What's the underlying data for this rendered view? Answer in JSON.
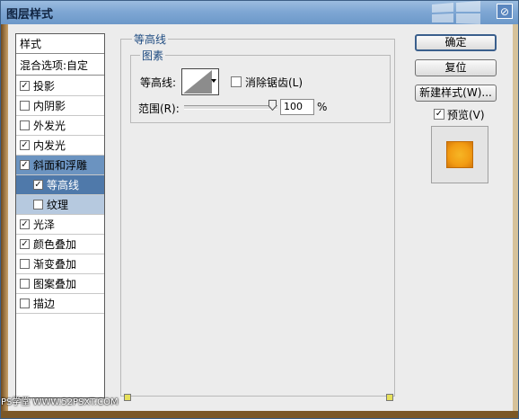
{
  "window": {
    "title": "图层样式",
    "close_icon": "close-icon"
  },
  "sidebar": {
    "header": "样式",
    "blend_options": "混合选项:自定",
    "items": [
      {
        "label": "投影",
        "checked": true
      },
      {
        "label": "内阴影",
        "checked": false
      },
      {
        "label": "外发光",
        "checked": false
      },
      {
        "label": "内发光",
        "checked": true
      },
      {
        "label": "斜面和浮雕",
        "checked": true
      },
      {
        "label": "等高线",
        "checked": true
      },
      {
        "label": "纹理",
        "checked": false
      },
      {
        "label": "光泽",
        "checked": true
      },
      {
        "label": "颜色叠加",
        "checked": true
      },
      {
        "label": "渐变叠加",
        "checked": false
      },
      {
        "label": "图案叠加",
        "checked": false
      },
      {
        "label": "描边",
        "checked": false
      }
    ]
  },
  "panel": {
    "title": "等高线",
    "group_title": "图素",
    "contour_label": "等高线:",
    "antialias_label": "消除锯齿(L)",
    "antialias_checked": false,
    "range_label": "范围(R):",
    "range_value": "100",
    "range_unit": "%",
    "range_level_percent": 100
  },
  "buttons": {
    "ok": "确定",
    "reset": "复位",
    "new_style": "新建样式(W)...",
    "preview_label": "预览(V)",
    "preview_checked": true
  },
  "watermark": "PS学堂 WWW.52PSXT.COM",
  "colors": {
    "titlebar": "#7fa7d4",
    "selection": "#4f79aa",
    "preview_swatch": "#f29c13"
  }
}
